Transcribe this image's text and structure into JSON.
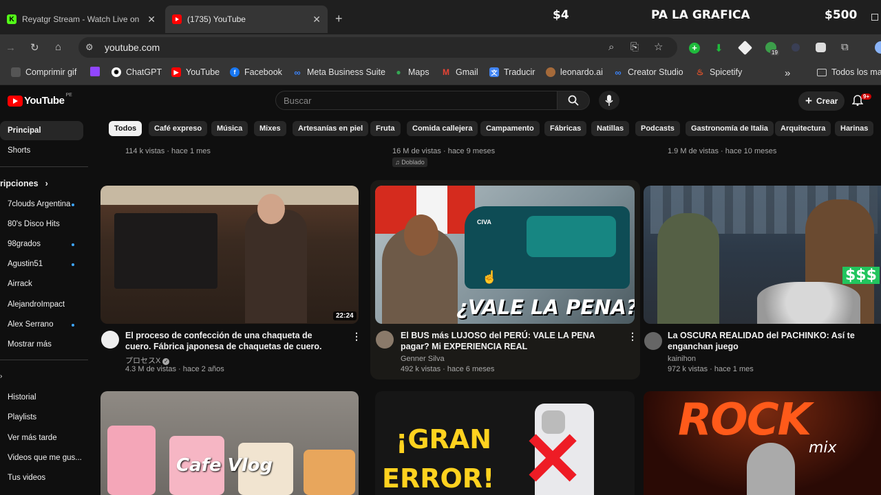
{
  "browser": {
    "tabs": [
      {
        "title": "Reyatgr Stream - Watch Live on",
        "favicon": "K",
        "color": "#53fc18"
      },
      {
        "title": "(1735) YouTube",
        "favicon": "youtube",
        "color": "#ff0000"
      }
    ],
    "overlay": {
      "left": "$4",
      "center": "PA LA GRAFICA",
      "right": "$500"
    },
    "url": "youtube.com",
    "bookmarks": [
      "Comprimir gif",
      "ChatGPT",
      "YouTube",
      "Facebook",
      "Meta Business Suite",
      "Maps",
      "Gmail",
      "Traducir",
      "leonardo.ai",
      "Creator Studio",
      "Spicetify"
    ],
    "bookmarks_more": "»",
    "all_bookmarks": "Todos los ma",
    "extension_badge": "19"
  },
  "header": {
    "logo_text": "YouTube",
    "country": "PE",
    "search_placeholder": "Buscar",
    "create_label": "Crear",
    "notification_badge": "9+"
  },
  "sidebar": {
    "main": [
      "Principal",
      "Shorts"
    ],
    "subs_title": "ripciones",
    "subs": [
      {
        "name": "7clouds Argentina",
        "dot": true
      },
      {
        "name": "80's Disco Hits",
        "dot": false
      },
      {
        "name": "98grados",
        "dot": true
      },
      {
        "name": "Agustin51",
        "dot": true
      },
      {
        "name": "Airrack",
        "dot": false
      },
      {
        "name": "AlejandroImpact",
        "dot": false
      },
      {
        "name": "Alex Serrano",
        "dot": true
      },
      {
        "name": "Mostrar más",
        "dot": false
      }
    ],
    "you": [
      "Historial",
      "Playlists",
      "Ver más tarde",
      "Videos que me gus...",
      "Tus videos"
    ]
  },
  "chips": [
    "Todos",
    "Café expreso",
    "Música",
    "Mixes",
    "Artesanías en piel",
    "Fruta",
    "Comida callejera",
    "Campamento",
    "Fábricas",
    "Natillas",
    "Podcasts",
    "Gastronomía de Italia",
    "Arquitectura",
    "Harinas"
  ],
  "top_row_meta": [
    {
      "meta": "114 k vistas · hace 1 mes",
      "badge": ""
    },
    {
      "meta": "16 M de vistas · hace 9 meses",
      "badge": "Doblado"
    },
    {
      "meta": "1.9 M de vistas · hace 10 meses",
      "badge": ""
    }
  ],
  "videos": [
    {
      "title": "El proceso de confección de una chaqueta de cuero. Fábrica japonesa de chaquetas de cuero.",
      "channel": "プロセスX",
      "verified": true,
      "meta": "4.3 M de vistas · hace 2 años",
      "duration": "22:24"
    },
    {
      "title": "El BUS más LUJOSO del PERÚ: VALE LA PENA pagar? Mi EXPERIENCIA REAL",
      "channel": "Genner Silva",
      "verified": false,
      "meta": "492 k vistas · hace 6 meses",
      "duration": "",
      "thumb_text": "¿VALE LA PENA?",
      "bus_brand": "CIVA"
    },
    {
      "title": "La OSCURA REALIDAD del PACHINKO: Así te enganchan juego",
      "channel": "kainihon",
      "verified": false,
      "meta": "972 k vistas · hace 1 mes",
      "duration": "",
      "thumb_text": "$$$"
    }
  ],
  "bottom_thumbs": [
    {
      "text": "Cafe Vlog"
    },
    {
      "text_line1": "¡GRAN",
      "text_line2": "ERROR!"
    },
    {
      "text": "ROCK",
      "sub": "mix"
    }
  ],
  "colors": {
    "accent": "#3ea6ff",
    "youtube_red": "#ff0000",
    "bg": "#0f0f0f"
  }
}
